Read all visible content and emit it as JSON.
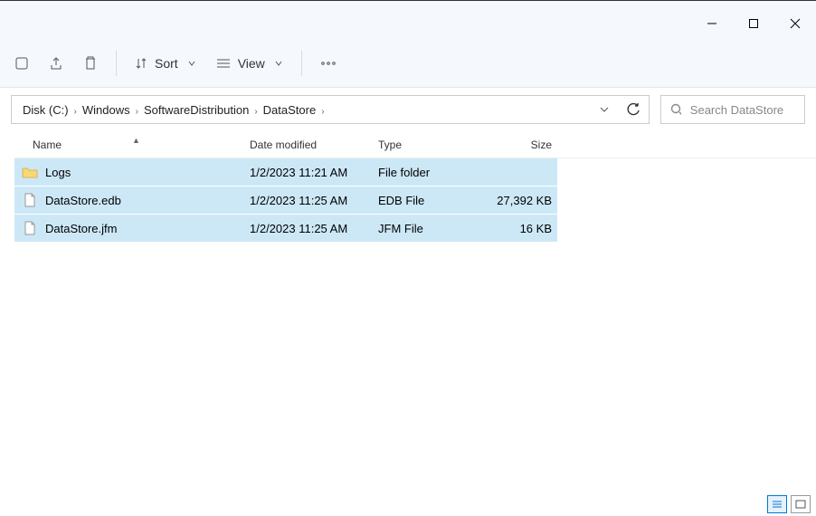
{
  "toolbar": {
    "sort_label": "Sort",
    "view_label": "View"
  },
  "breadcrumb": [
    "Disk (C:)",
    "Windows",
    "SoftwareDistribution",
    "DataStore"
  ],
  "search": {
    "placeholder": "Search DataStore"
  },
  "columns": {
    "name": "Name",
    "date": "Date modified",
    "type": "Type",
    "size": "Size"
  },
  "rows": [
    {
      "name": "Logs",
      "date": "1/2/2023 11:21 AM",
      "type": "File folder",
      "size": "",
      "icon": "folder"
    },
    {
      "name": "DataStore.edb",
      "date": "1/2/2023 11:25 AM",
      "type": "EDB File",
      "size": "27,392 KB",
      "icon": "file"
    },
    {
      "name": "DataStore.jfm",
      "date": "1/2/2023 11:25 AM",
      "type": "JFM File",
      "size": "16 KB",
      "icon": "file"
    }
  ]
}
